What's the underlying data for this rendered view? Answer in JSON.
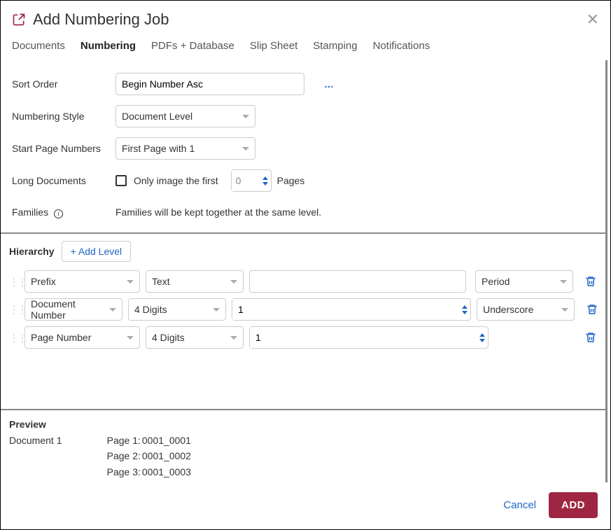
{
  "dialog": {
    "title": "Add Numbering Job"
  },
  "tabs": [
    "Documents",
    "Numbering",
    "PDFs + Database",
    "Slip Sheet",
    "Stamping",
    "Notifications"
  ],
  "activeTabIndex": 1,
  "form": {
    "sortOrder": {
      "label": "Sort Order",
      "value": "Begin Number Asc"
    },
    "numberingStyle": {
      "label": "Numbering Style",
      "value": "Document Level"
    },
    "startPageNumbers": {
      "label": "Start Page Numbers",
      "value": "First Page with 1"
    },
    "longDocuments": {
      "label": "Long Documents",
      "checkboxLabel": "Only image the first",
      "value": "0",
      "suffix": "Pages"
    },
    "families": {
      "label": "Families",
      "text": "Families will be kept together at the same level."
    }
  },
  "hierarchy": {
    "title": "Hierarchy",
    "addLabel": "+ Add Level",
    "rows": [
      {
        "name": "Prefix",
        "type": "Text",
        "value": "",
        "suffix": "Period",
        "spin": false,
        "hasSuffix": true
      },
      {
        "name": "Document Number",
        "type": "4 Digits",
        "value": "1",
        "suffix": "Underscore",
        "spin": true,
        "hasSuffix": true
      },
      {
        "name": "Page Number",
        "type": "4 Digits",
        "value": "1",
        "suffix": "",
        "spin": true,
        "hasSuffix": false
      }
    ]
  },
  "preview": {
    "title": "Preview",
    "docLabel": "Document 1",
    "rows": [
      {
        "page": "Page 1:",
        "value": "0001_0001"
      },
      {
        "page": "Page 2:",
        "value": "0001_0002"
      },
      {
        "page": "Page 3:",
        "value": "0001_0003"
      }
    ]
  },
  "footer": {
    "cancel": "Cancel",
    "add": "ADD"
  }
}
